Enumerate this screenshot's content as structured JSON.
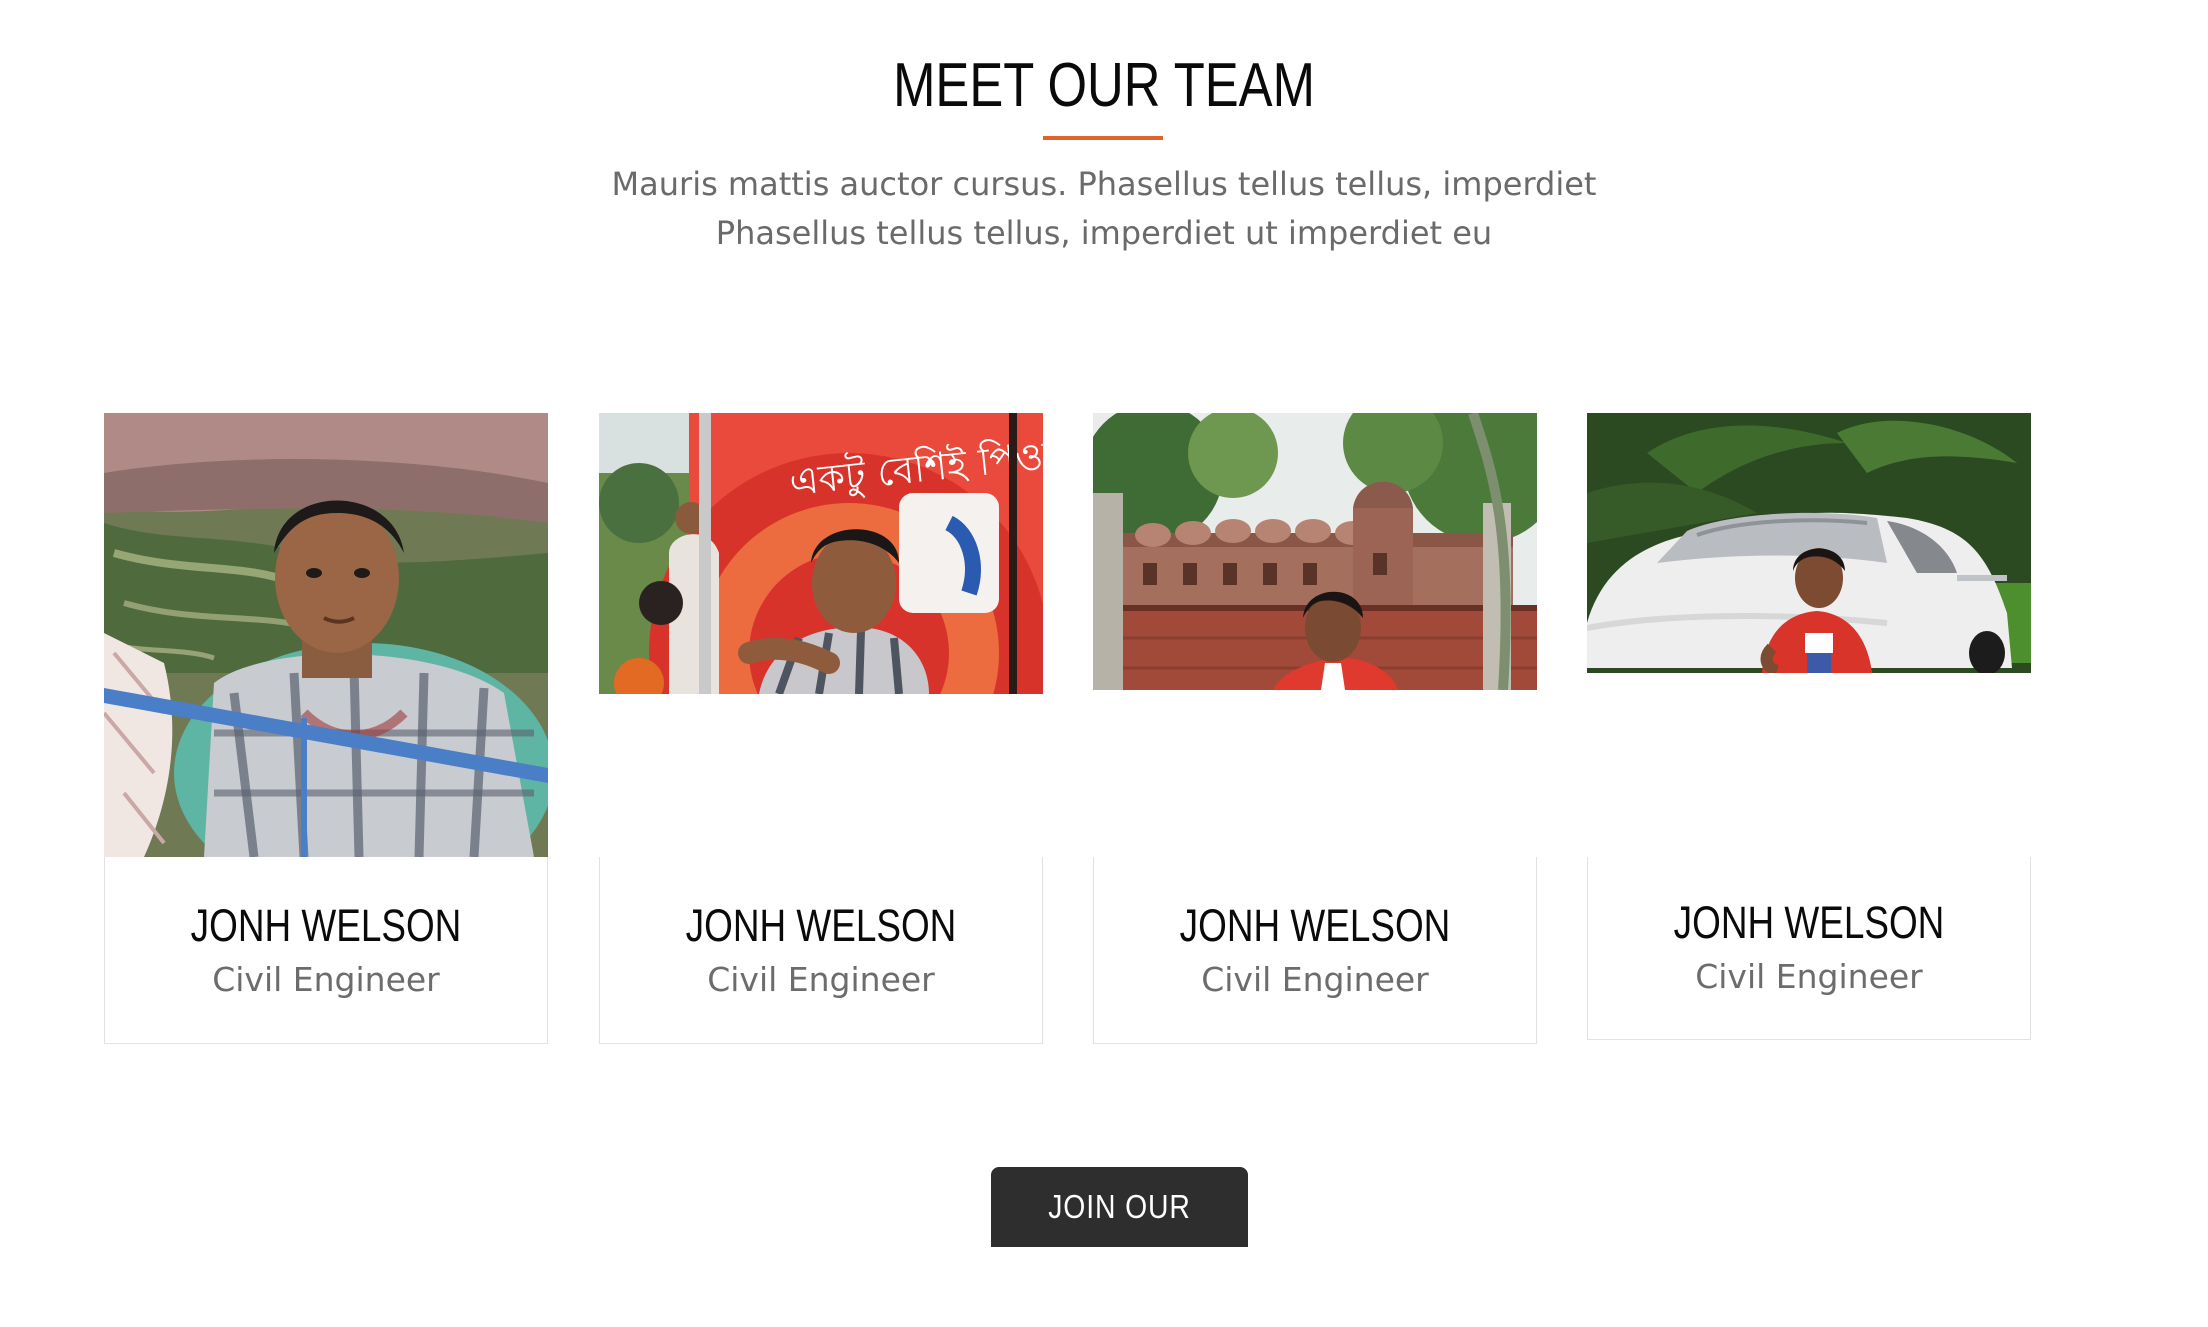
{
  "team_section": {
    "title": "MEET OUR TEAM",
    "description": "Mauris mattis auctor cursus. Phasellus tellus tellus, imperdiet Phasellus tellus tellus, imperdiet ut imperdiet eu",
    "accent_color": "#e2622b",
    "members": [
      {
        "name": "JONH WELSON",
        "role": "Civil Engineer",
        "photo_icon": "boy-on-boat-photo"
      },
      {
        "name": "JONH WELSON",
        "role": "Civil Engineer",
        "photo_icon": "boy-with-red-sign-photo",
        "sign_text": "একটু বেশিই পিওর!"
      },
      {
        "name": "JONH WELSON",
        "role": "Civil Engineer",
        "photo_icon": "boy-at-mosque-photo"
      },
      {
        "name": "JONH WELSON",
        "role": "Civil Engineer",
        "photo_icon": "boy-with-white-car-photo"
      }
    ],
    "join_button_label": "JOIN OUR TIME",
    "button_color": "#2e2e2e"
  }
}
